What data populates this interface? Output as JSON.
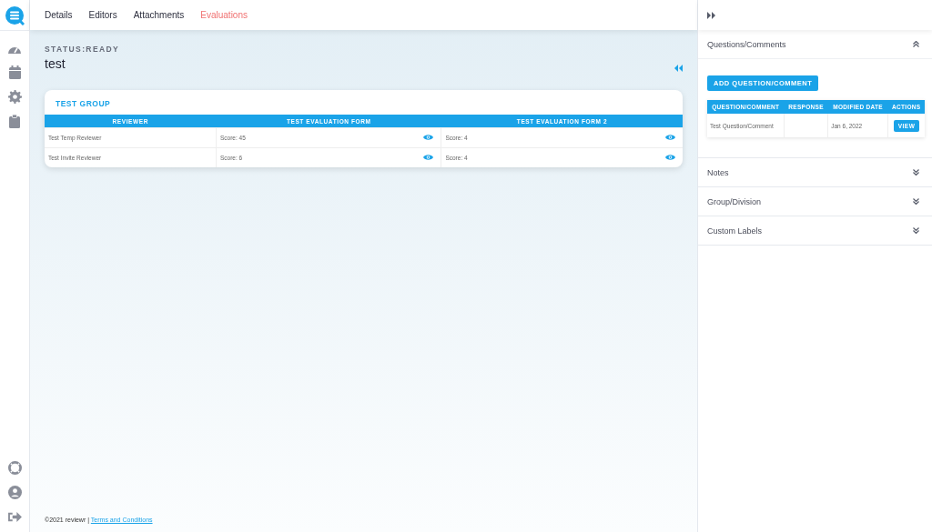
{
  "tabs": [
    {
      "label": "Details",
      "selected": false
    },
    {
      "label": "Editors",
      "selected": false
    },
    {
      "label": "Attachments",
      "selected": false
    },
    {
      "label": "Evaluations",
      "selected": true
    }
  ],
  "status": "STATUS:READY",
  "title": "test",
  "group": {
    "title": "TEST GROUP",
    "columns": [
      "REVIEWER",
      "TEST EVALUATION FORM",
      "TEST EVALUATION FORM 2"
    ],
    "rows": [
      {
        "reviewer": "Test Temp Reviewer",
        "scores": [
          "Score: 45",
          "Score: 4"
        ]
      },
      {
        "reviewer": "Test Invite Reviewer",
        "scores": [
          "Score: 6",
          "Score: 4"
        ]
      }
    ]
  },
  "footer": {
    "copyright": "©2021 reviewr |",
    "link": "Terms and Conditions"
  },
  "panel": {
    "sections": [
      {
        "title": "Questions/Comments",
        "expanded": true,
        "button": "ADD QUESTION/COMMENT",
        "columns": [
          "QUESTION/COMMENT",
          "RESPONSE",
          "MODIFIED DATE",
          "ACTIONS"
        ],
        "rows": [
          {
            "question": "Test Question/Comment",
            "modified": "Jan 6, 2022",
            "action": "VIEW"
          }
        ]
      },
      {
        "title": "Notes",
        "expanded": false
      },
      {
        "title": "Group/Division",
        "expanded": false
      },
      {
        "title": "Custom Labels",
        "expanded": false
      }
    ]
  }
}
